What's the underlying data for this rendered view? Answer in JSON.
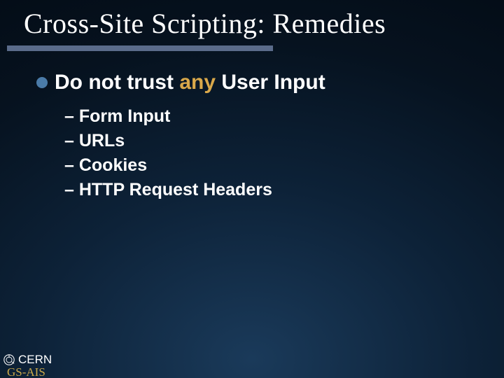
{
  "title": "Cross-Site Scripting: Remedies",
  "main": {
    "prefix": "Do not trust ",
    "emph": "any",
    "suffix": " User Input"
  },
  "subitems": [
    "– Form Input",
    "– URLs",
    "– Cookies",
    "– HTTP Request Headers"
  ],
  "footer": {
    "org": "CERN",
    "dept": "GS-AIS"
  }
}
